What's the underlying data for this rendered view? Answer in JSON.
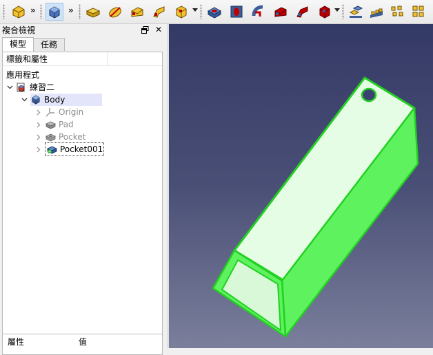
{
  "toolbar": {
    "overflow_glyph": "»",
    "groups": [
      {
        "icons": [
          "part-workbench-icon"
        ]
      },
      {
        "icons": [
          "partdesign-body-icon"
        ]
      },
      {
        "icons": [
          "pad-icon",
          "revolution-icon",
          "additive-loft-icon",
          "additive-pipe-icon",
          "additive-primitive-icon"
        ]
      },
      {
        "icons": [
          "pocket-icon",
          "hole-icon",
          "groove-icon",
          "subtractive-loft-icon",
          "subtractive-pipe-icon",
          "subtractive-primitive-icon"
        ]
      },
      {
        "icons": [
          "mirrored-icon",
          "linear-pattern-icon",
          "polar-pattern-icon",
          "multi-transform-icon"
        ]
      }
    ]
  },
  "combo_view": {
    "title": "複合檢視",
    "float_glyph": "🗗",
    "close_glyph": "✕",
    "tabs": [
      "模型",
      "任務"
    ],
    "selected_tab": "模型",
    "tree_header": {
      "label": "標籤和屬性",
      "value": ""
    },
    "app_label": "應用程式",
    "document": "練習二",
    "body": "Body",
    "children": [
      {
        "label": "Origin",
        "icon": "origin-icon",
        "muted": true
      },
      {
        "label": "Pad",
        "icon": "pad-feature-icon",
        "muted": true
      },
      {
        "label": "Pocket",
        "icon": "pocket-feature-icon",
        "muted": true
      },
      {
        "label": "Pocket001",
        "icon": "pocket-tip-icon",
        "muted": false,
        "selected": true
      }
    ],
    "property_headers": {
      "property": "屬性",
      "value": "值"
    }
  },
  "viewport": {
    "background_top": "#343a66",
    "background_bottom": "#7b7f9c",
    "model_face_light": "#e4fde4",
    "model_face_side": "#5ff25f",
    "model_edge": "#22d022"
  }
}
